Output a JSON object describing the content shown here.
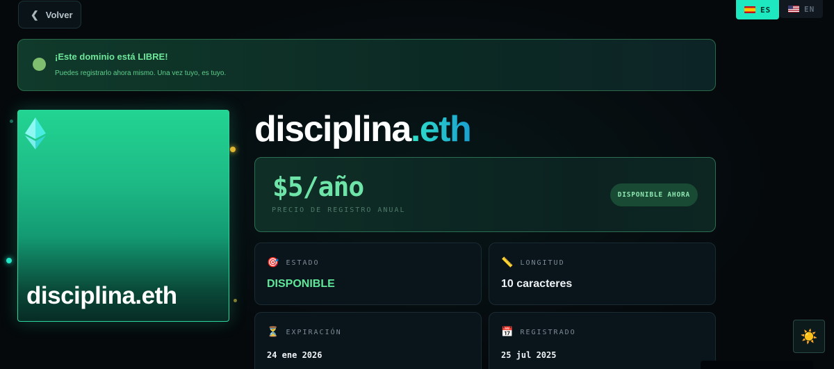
{
  "nav": {
    "back_label": "Volver",
    "back_icon": "chevron-left-icon"
  },
  "language": {
    "options": [
      {
        "code": "ES",
        "flag": "spain-flag-icon",
        "active": true
      },
      {
        "code": "EN",
        "flag": "us-flag-icon",
        "active": false
      }
    ]
  },
  "alert": {
    "title": "¡Este dominio está LIBRE!",
    "message": "Puedes registrarlo ahora mismo. Una vez tuyo, es tuyo."
  },
  "card": {
    "name": "disciplina.eth",
    "logo": "ethereum-icon"
  },
  "domain": {
    "name": "disciplina",
    "tld": ".eth"
  },
  "price": {
    "value": "$5/año",
    "label": "PRECIO DE REGISTRO ANUAL",
    "badge": "DISPONIBLE AHORA"
  },
  "stats": [
    {
      "icon": "🎯",
      "label": "ESTADO",
      "value": "DISPONIBLE"
    },
    {
      "icon": "📏",
      "label": "LONGITUD",
      "value": "10 caracteres"
    },
    {
      "icon": "⏳",
      "label": "EXPIRACIÓN",
      "value": "24 ene 2026"
    },
    {
      "icon": "📅",
      "label": "REGISTRADO",
      "value": "25 jul 2025"
    }
  ],
  "theme_toggle": {
    "icon": "☀️"
  },
  "colors": {
    "accent": "#1ee8c0",
    "success": "#5fe79a",
    "background": "#05090c"
  }
}
